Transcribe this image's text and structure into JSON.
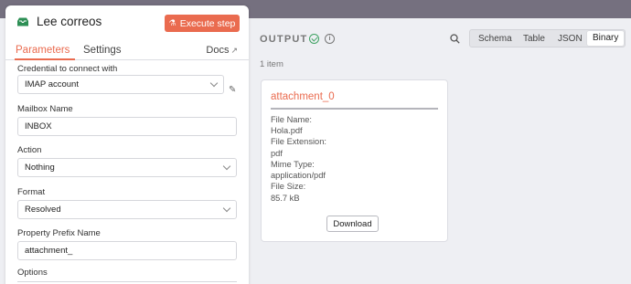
{
  "node": {
    "title": "Lee correos",
    "execute_label": "Execute step"
  },
  "tabs": {
    "parameters": "Parameters",
    "settings": "Settings",
    "docs": "Docs"
  },
  "fields": {
    "credential_label": "Credential to connect with",
    "credential_value": "IMAP account",
    "mailbox_label": "Mailbox Name",
    "mailbox_value": "INBOX",
    "action_label": "Action",
    "action_value": "Nothing",
    "format_label": "Format",
    "format_value": "Resolved",
    "prefix_label": "Property Prefix Name",
    "prefix_value": "attachment_",
    "options_label": "Options"
  },
  "output": {
    "label": "OUTPUT",
    "item_count": "1 item",
    "views": [
      "Schema",
      "Table",
      "JSON",
      "Binary"
    ],
    "active_view": "Binary"
  },
  "card": {
    "title": "attachment_0",
    "file_name_label": "File Name:",
    "file_name": "Hola.pdf",
    "file_ext_label": "File Extension:",
    "file_ext": "pdf",
    "mime_label": "Mime Type:",
    "mime": "application/pdf",
    "size_label": "File Size:",
    "size": "85.7 kB",
    "download_label": "Download"
  },
  "colors": {
    "accent": "#ea6b4f",
    "success": "#3fa263"
  }
}
